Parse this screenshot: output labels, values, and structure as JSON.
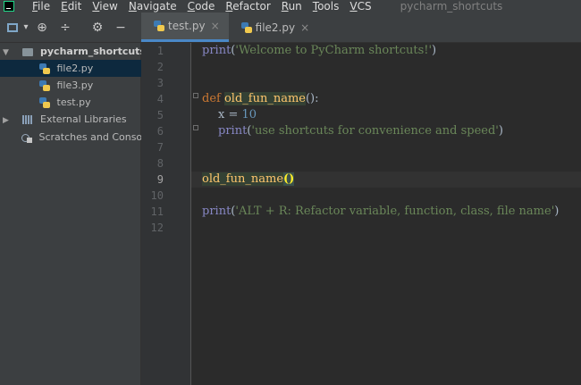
{
  "menubar": {
    "items": [
      {
        "mnemonic": "F",
        "rest": "ile"
      },
      {
        "mnemonic": "E",
        "rest": "dit"
      },
      {
        "mnemonic": "V",
        "rest": "iew"
      },
      {
        "mnemonic": "N",
        "rest": "avigate"
      },
      {
        "mnemonic": "C",
        "rest": "ode"
      },
      {
        "mnemonic": "R",
        "rest": "efactor"
      },
      {
        "mnemonic": "R",
        "rest": "un"
      },
      {
        "mnemonic": "T",
        "rest": "ools"
      },
      {
        "mnemonic": "V",
        "rest": "CS"
      }
    ],
    "project_title": "pycharm_shortcuts"
  },
  "toolbar": {
    "view_dropdown": "▾",
    "target_icon": "⊕",
    "collapse_icon": "÷",
    "settings_icon": "⚙",
    "hide_icon": "−"
  },
  "tabs": [
    {
      "label": "test.py",
      "close": "×",
      "active": true
    },
    {
      "label": "file2.py",
      "close": "×",
      "active": false
    }
  ],
  "project_tree": {
    "root": "pycharm_shortcuts",
    "files": [
      "file2.py",
      "file3.py",
      "test.py"
    ],
    "external_libraries": "External Libraries",
    "scratches": "Scratches and Conso"
  },
  "editor": {
    "line_numbers": [
      "1",
      "2",
      "3",
      "4",
      "5",
      "6",
      "7",
      "8",
      "9",
      "10",
      "11",
      "12"
    ],
    "current_line": 9,
    "lines": {
      "l1": {
        "fn": "print",
        "open": "(",
        "str": "'Welcome to PyCharm shortcuts!'",
        "close": ")"
      },
      "l4": {
        "kw": "def",
        "name": "old_fun_name",
        "rest": "():"
      },
      "l5": {
        "var": "x",
        "op": " = ",
        "num": "10"
      },
      "l6": {
        "fn": "print",
        "open": "(",
        "str": "'use shortcuts for convenience and speed'",
        "close": ")"
      },
      "l9": {
        "name": "old_fun_name",
        "open": "(",
        "close": ")"
      },
      "l11": {
        "fn": "print",
        "open": "(",
        "str": "'ALT + R: Refactor variable, function, class, file name'",
        "close": ")"
      }
    }
  }
}
